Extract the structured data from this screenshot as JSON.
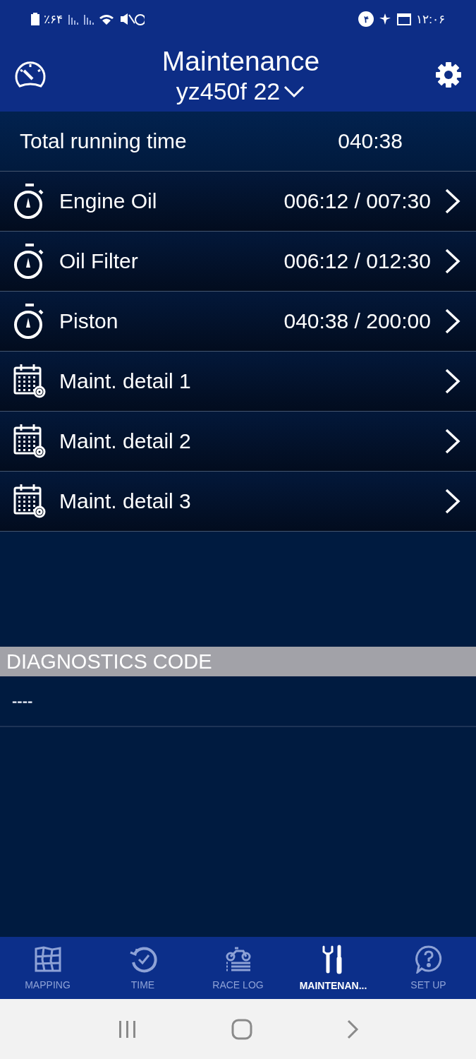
{
  "status_bar": {
    "battery": "٪۶۴",
    "badge": "۴",
    "time": "۱۲:۰۶"
  },
  "header": {
    "title": "Maintenance",
    "vehicle": "yz450f 22"
  },
  "total": {
    "label": "Total running time",
    "value": "040:38"
  },
  "items": [
    {
      "kind": "timer",
      "label": "Engine Oil",
      "value": "006:12 / 007:30"
    },
    {
      "kind": "timer",
      "label": "Oil Filter",
      "value": "006:12 / 012:30"
    },
    {
      "kind": "timer",
      "label": "Piston",
      "value": "040:38 / 200:00"
    },
    {
      "kind": "calendar",
      "label": "Maint. detail 1"
    },
    {
      "kind": "calendar",
      "label": "Maint. detail 2"
    },
    {
      "kind": "calendar",
      "label": "Maint. detail 3"
    }
  ],
  "diagnostics": {
    "title": "DIAGNOSTICS CODE",
    "value": "----"
  },
  "tabs": [
    {
      "kind": "map",
      "label": "MAPPING",
      "selected": false
    },
    {
      "kind": "time",
      "label": "TIME",
      "selected": false
    },
    {
      "kind": "log",
      "label": "RACE LOG",
      "selected": false
    },
    {
      "kind": "tools",
      "label": "MAINTENAN...",
      "selected": true
    },
    {
      "kind": "help",
      "label": "SET UP",
      "selected": false
    }
  ]
}
